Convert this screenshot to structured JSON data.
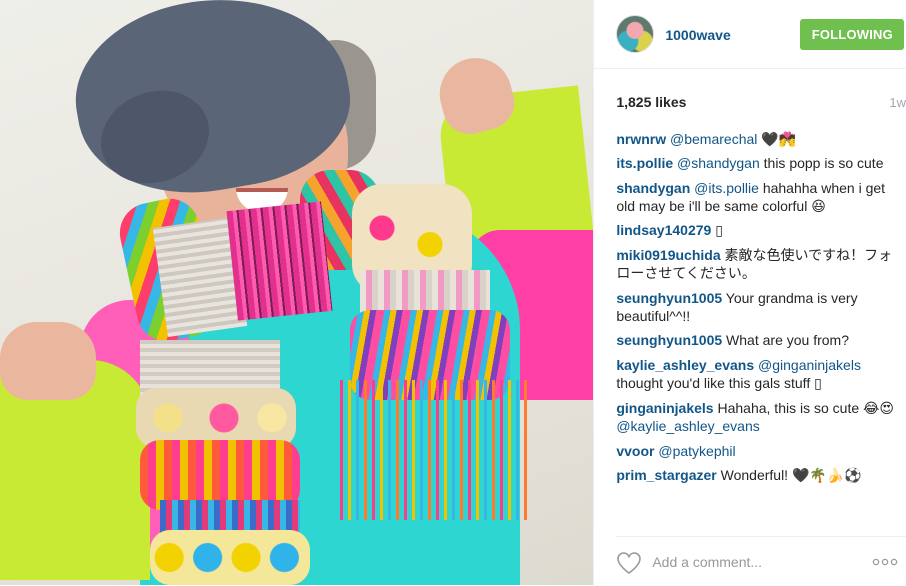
{
  "post": {
    "image_alt": "Smiling elderly woman in a denim cap and neon sweater wearing a colorful knitted scarf"
  },
  "header": {
    "username": "1000wave",
    "follow_label": "FOLLOWING",
    "avatar_icon": "profile-avatar"
  },
  "stats": {
    "likes": "1,825 likes",
    "age": "1w"
  },
  "comments": [
    {
      "author": "nrwnrw",
      "mention": "@bemarechal",
      "text": " 🖤💏"
    },
    {
      "author": "its.pollie",
      "mention": "@shandygan",
      "text": " this popp is so cute"
    },
    {
      "author": "shandygan",
      "mention": "@its.pollie",
      "text": " hahahha when i get old may be i'll be same colorful 😆"
    },
    {
      "author": "lindsay140279",
      "mention": "",
      "text": " ▯"
    },
    {
      "author": "miki0919uchida",
      "mention": "",
      "text": " 素敵な色使いですね！フォローさせてください。"
    },
    {
      "author": "seunghyun1005",
      "mention": "",
      "text": " Your grandma is very beautiful^^!!"
    },
    {
      "author": "seunghyun1005",
      "mention": "",
      "text": " What are you from?"
    },
    {
      "author": "kaylie_ashley_evans",
      "mention": "@ginganinjakels",
      "text": " thought you'd like this gals stuff ▯"
    },
    {
      "author": "ginganinjakels",
      "mention": "",
      "text": " Hahaha, this is so cute 😂😍 ",
      "mention_after": "@kaylie_ashley_evans"
    },
    {
      "author": "vvoor",
      "mention": "@patykephil",
      "text": ""
    },
    {
      "author": "prim_stargazer",
      "mention": "",
      "text": " Wonderful! 🖤🌴🍌⚽"
    }
  ],
  "footer": {
    "comment_placeholder": "Add a comment...",
    "like_icon": "heart-icon",
    "more_icon": "more-options-icon"
  },
  "colors": {
    "link": "#125688",
    "follow_button": "#70c050",
    "muted": "#a5a7aa"
  }
}
